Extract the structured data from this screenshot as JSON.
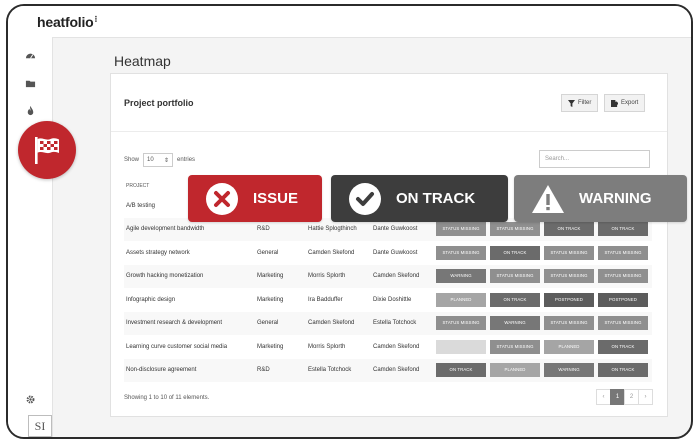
{
  "app": {
    "logo": "heatfolio",
    "logo_dots": "⁝"
  },
  "page": {
    "title": "Heatmap"
  },
  "card": {
    "title": "Project portfolio",
    "filter_label": "Filter",
    "export_label": "Export"
  },
  "controls": {
    "show_label": "Show",
    "show_value": "10",
    "entries_label": "entries",
    "search_placeholder": "Search..."
  },
  "table": {
    "columns": [
      "PROJECT",
      "",
      "",
      "",
      "",
      "",
      "",
      ""
    ],
    "rows": [
      {
        "project": "A/B testing",
        "category": "",
        "owner": "",
        "manager": "",
        "statuses": [
          "",
          "",
          "",
          ""
        ]
      },
      {
        "project": "Agile development bandwidth",
        "category": "R&D",
        "owner": "Hattie Splogthinch",
        "manager": "Dante Guwkoost",
        "statuses": [
          "STATUS MISSING",
          "STATUS MISSING",
          "ON TRACK",
          "ON TRACK"
        ]
      },
      {
        "project": "Assets strategy network",
        "category": "General",
        "owner": "Camden Skefond",
        "manager": "Dante Guwkoost",
        "statuses": [
          "STATUS MISSING",
          "ON TRACK",
          "STATUS MISSING",
          "STATUS MISSING"
        ]
      },
      {
        "project": "Growth hacking monetization",
        "category": "Marketing",
        "owner": "Morris Splorth",
        "manager": "Camden Skefond",
        "statuses": [
          "WARNING",
          "STATUS MISSING",
          "STATUS MISSING",
          "STATUS MISSING"
        ]
      },
      {
        "project": "Infographic design",
        "category": "Marketing",
        "owner": "Ira Badduffer",
        "manager": "Dixie Doshittle",
        "statuses": [
          "PLANNED",
          "ON TRACK",
          "POSTPONED",
          "POSTPONED"
        ]
      },
      {
        "project": "Investment research & development",
        "category": "General",
        "owner": "Camden Skefond",
        "manager": "Estella Totchock",
        "statuses": [
          "STATUS MISSING",
          "WARNING",
          "STATUS MISSING",
          "STATUS MISSING"
        ]
      },
      {
        "project": "Learning curve customer social media",
        "category": "Marketing",
        "owner": "Morris Splorth",
        "manager": "Camden Skefond",
        "statuses": [
          "",
          "STATUS MISSING",
          "PLANNED",
          "ON TRACK"
        ]
      },
      {
        "project": "Non-disclosure agreement",
        "category": "R&D",
        "owner": "Estella Totchock",
        "manager": "Camden Skefond",
        "statuses": [
          "ON TRACK",
          "PLANNED",
          "WARNING",
          "ON TRACK"
        ]
      }
    ]
  },
  "footer": {
    "showing_text": "Showing 1 to 10 of 11 elements.",
    "pages": [
      "‹",
      "1",
      "2",
      "›"
    ],
    "active_page": "1"
  },
  "legend": {
    "issue": "ISSUE",
    "on_track": "ON TRACK",
    "warning": "WARNING"
  },
  "user": {
    "initials": "SI"
  },
  "colors": {
    "issue": "#c0272d",
    "on_track": "#3d3d3d",
    "warning": "#7d7d7d"
  },
  "sidebar": {
    "icons": [
      "dashboard-icon",
      "folder-icon",
      "flame-icon",
      "gear-icon"
    ]
  }
}
